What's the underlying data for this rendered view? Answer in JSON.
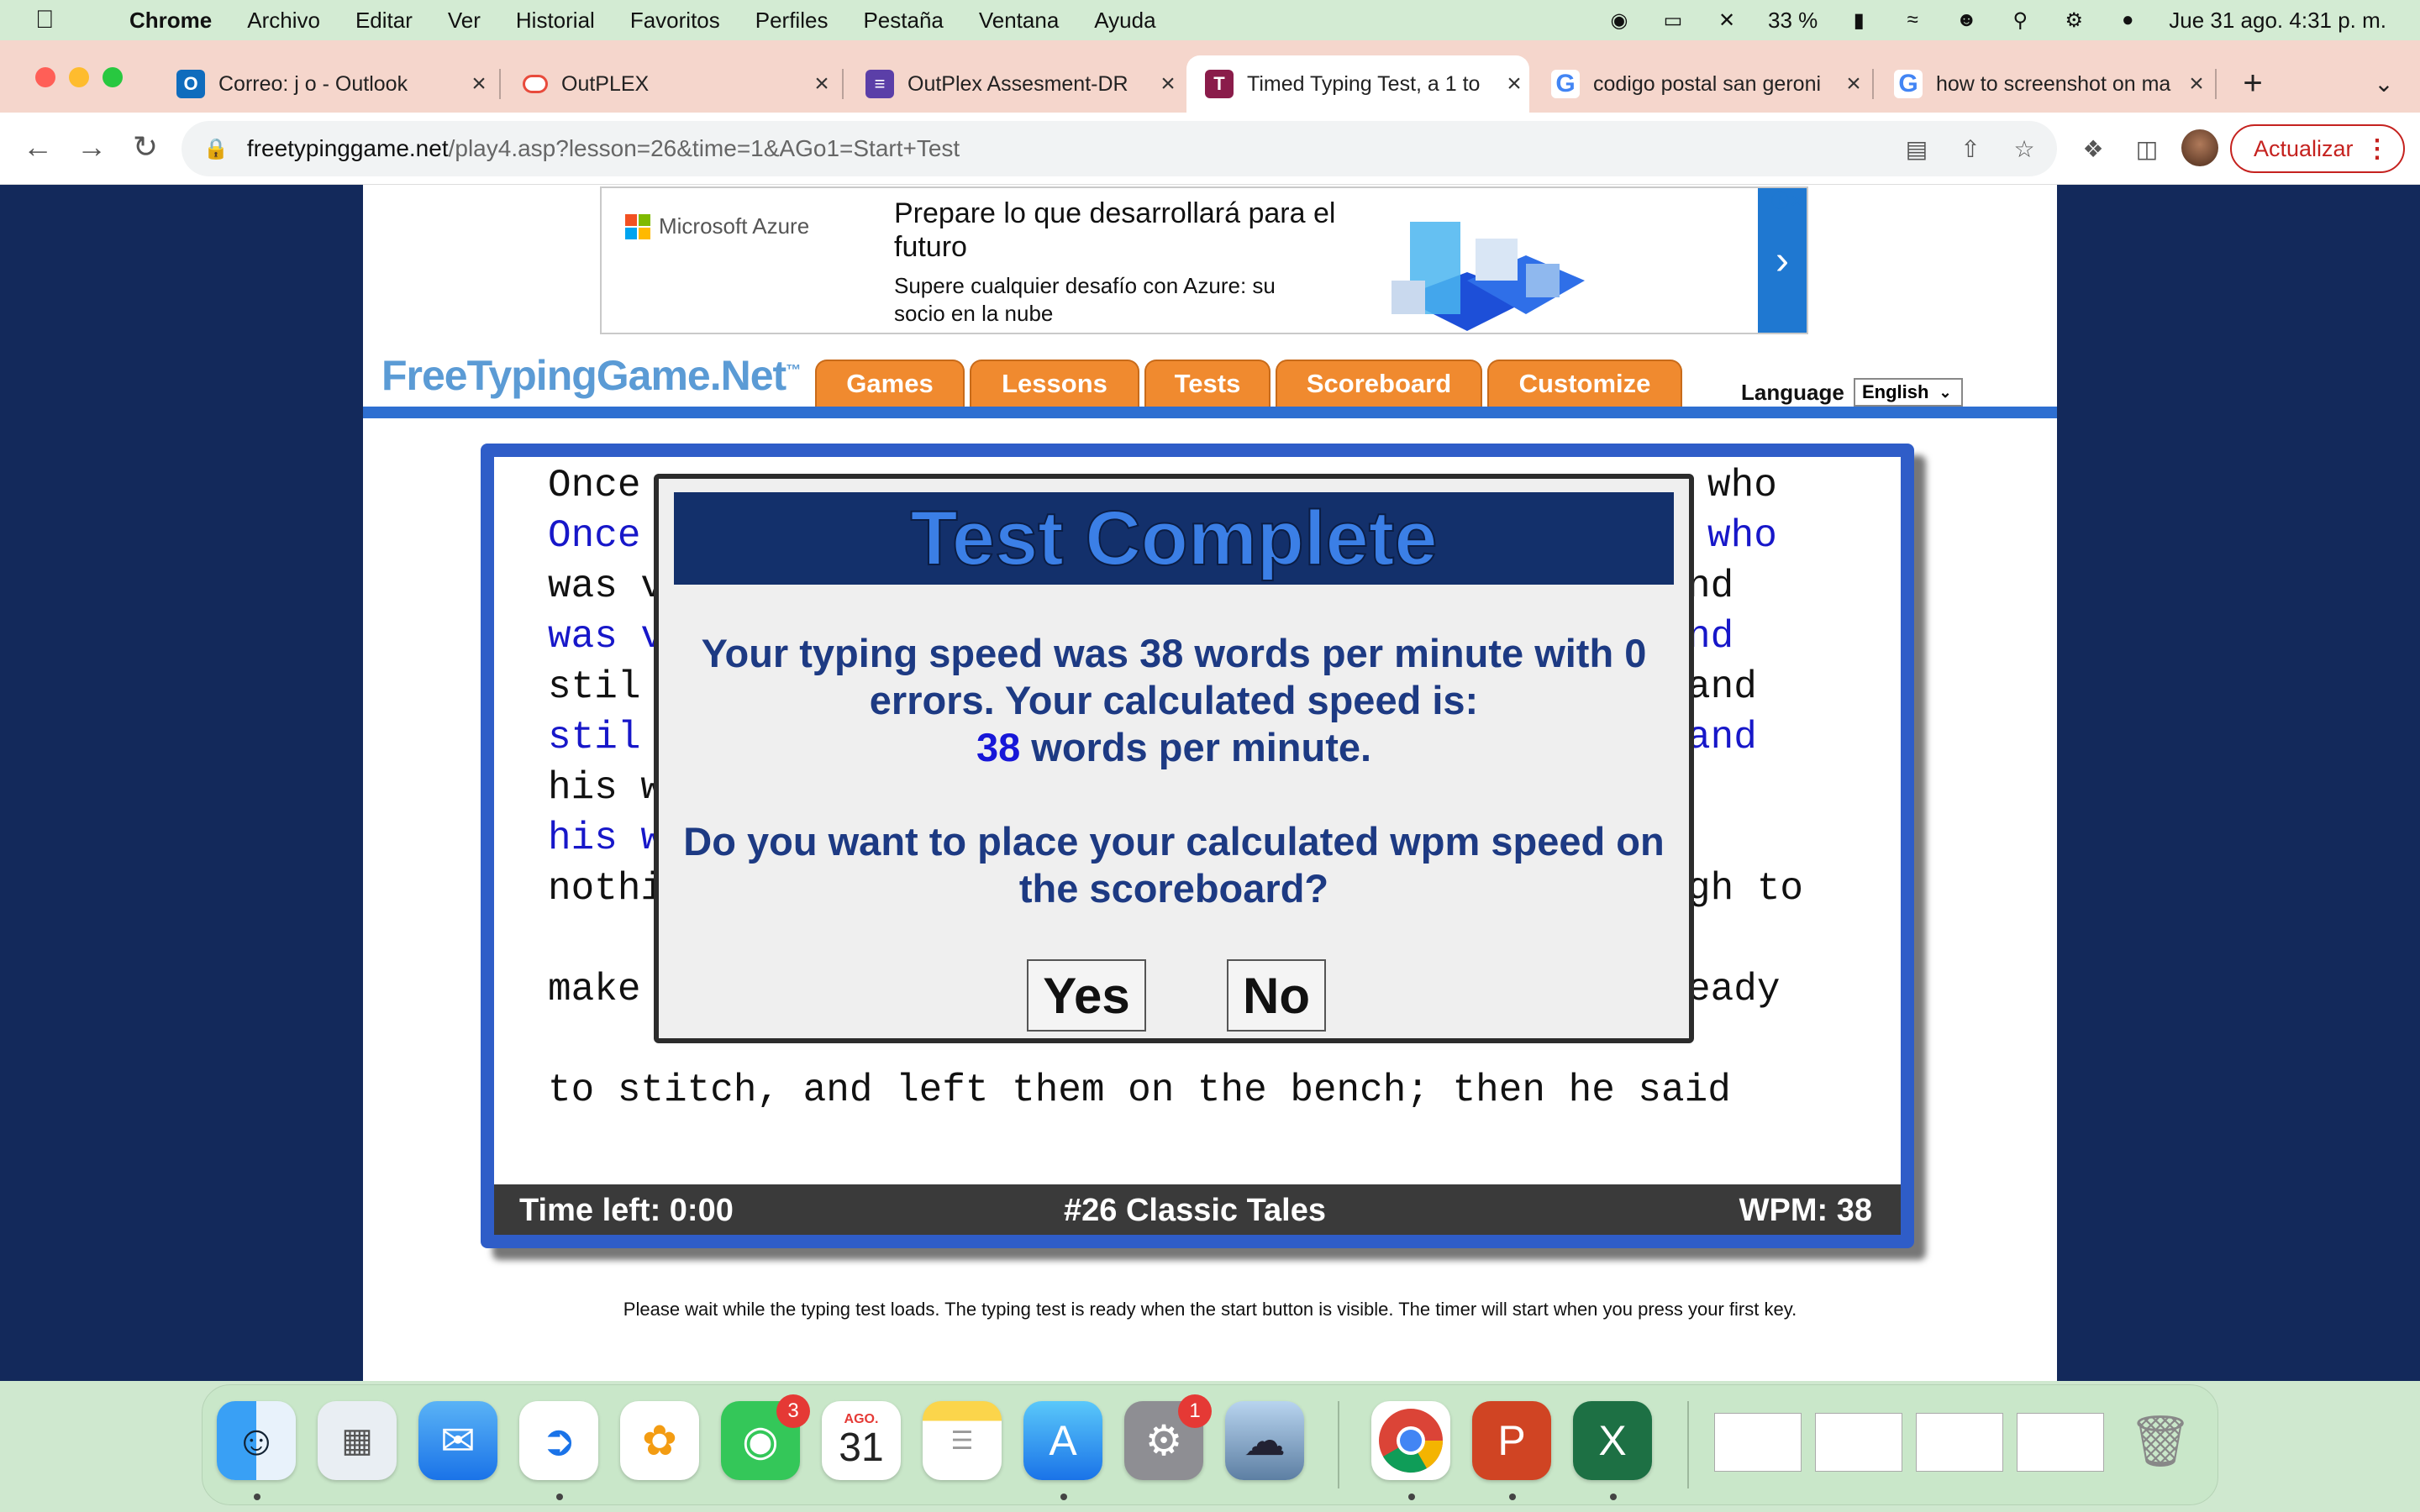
{
  "menubar": {
    "app": "Chrome",
    "items": [
      "Archivo",
      "Editar",
      "Ver",
      "Historial",
      "Favoritos",
      "Perfiles",
      "Pestaña",
      "Ventana",
      "Ayuda"
    ],
    "battery": "33 %",
    "datetime": "Jue 31 ago.  4:31 p. m."
  },
  "tabs": [
    {
      "title": "Correo: j o - Outlook",
      "icon": "outlook-icon"
    },
    {
      "title": "OutPLEX",
      "icon": "outplex-icon"
    },
    {
      "title": "OutPlex Assesment-DR",
      "icon": "forms-icon"
    },
    {
      "title": "Timed Typing Test, a 1 to",
      "icon": "typing-icon"
    },
    {
      "title": "codigo postal san geroni",
      "icon": "google-icon"
    },
    {
      "title": "how to screenshot on ma",
      "icon": "google-icon"
    }
  ],
  "address": {
    "host": "freetypinggame.net",
    "path": "/play4.asp?lesson=26&time=1&AGo1=Start+Test",
    "update_label": "Actualizar"
  },
  "ad": {
    "brand": "Microsoft Azure",
    "headline": "Prepare lo que desarrollará para el futuro",
    "sub": "Supere cualquier desafío con Azure: su socio en la nube"
  },
  "site": {
    "logo": "FreeTypingGame.Net",
    "logo_tm": "™",
    "nav": [
      "Games",
      "Lessons",
      "Tests",
      "Scoreboard",
      "Customize"
    ],
    "language_label": "Language",
    "language_value": "English"
  },
  "typing": {
    "left_lines": [
      "Once",
      "Once",
      "was v",
      "was v",
      "stil",
      "stil",
      "his w",
      "his w",
      "nothi",
      "make",
      "to stitch, and left them on the bench; then he said"
    ],
    "right_lines": [
      "who",
      "who",
      "nd",
      "nd",
      "and",
      "and",
      "gh to",
      "eady"
    ]
  },
  "status": {
    "time_left": "Time left: 0:00",
    "lesson": "#26 Classic Tales",
    "wpm": "WPM: 38"
  },
  "modal": {
    "title": "Test Complete",
    "line1": "Your typing speed was 38 words per minute with 0",
    "line2": "errors. Your calculated speed is:",
    "speed": "38",
    "speed_suffix": " words per minute.",
    "question1": "Do you want to place your calculated wpm speed on",
    "question2": "the scoreboard?",
    "yes": "Yes",
    "no": "No"
  },
  "footnote": "Please wait while the typing test loads. The typing test is ready when the start button is visible. The timer will start when you press your first key.",
  "dock": {
    "facetime_badge": "3",
    "calendar_month": "AGO.",
    "calendar_day": "31",
    "settings_badge": "1"
  },
  "colors": {
    "page_bg": "#13295b",
    "nav_orange": "#f08a2f",
    "modal_title_bg": "#13306b",
    "modal_text": "#1d3a83"
  }
}
